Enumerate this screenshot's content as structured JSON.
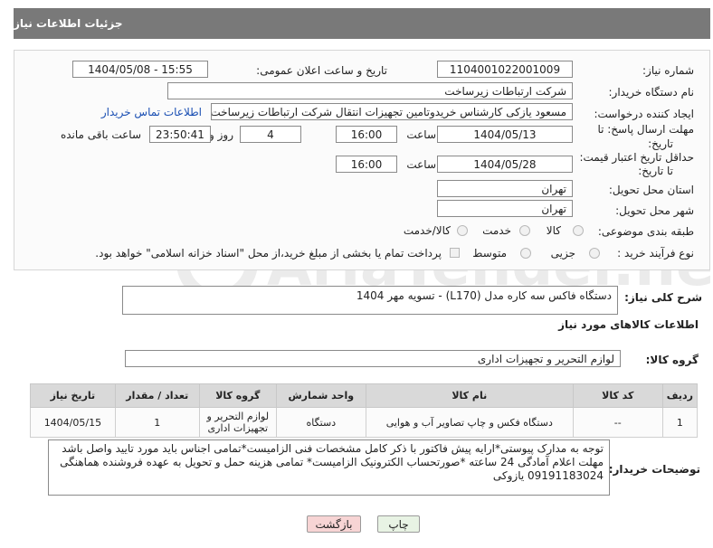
{
  "header": {
    "title": "جزئیات اطلاعات نیاز"
  },
  "form": {
    "need_number_label": "شماره نیاز:",
    "need_number": "1104001022001009",
    "announce_label": "تاریخ و ساعت اعلان عمومی:",
    "announce_value": "1404/05/08 - 15:55",
    "buyer_org_label": "نام دستگاه خریدار:",
    "buyer_org": "شرکت ارتباطات زیرساخت",
    "creator_label": "ایجاد کننده درخواست:",
    "creator": "مسعود یازکی کارشناس خریدوتامین تجهیزات انتقال شرکت ارتباطات زیرساخت",
    "contact_link": "اطلاعات تماس خریدار",
    "deadline_label_1": "مهلت ارسال پاسخ: تا",
    "deadline_label_2": "تاریخ:",
    "deadline_date": "1404/05/13",
    "time_label": "ساعت",
    "deadline_time": "16:00",
    "days_value": "4",
    "days_label": "روز و",
    "remaining_time": "23:50:41",
    "remaining_label": "ساعت باقی مانده",
    "min_price_label_1": "حداقل تاریخ اعتبار قیمت:",
    "min_price_label_2": "تا تاریخ:",
    "price_date": "1404/05/28",
    "price_time": "16:00",
    "province_label": "استان محل تحویل:",
    "province": "تهران",
    "city_label": "شهر محل تحویل:",
    "city": "تهران",
    "category_label": "طبقه بندی موضوعی:",
    "category_options": [
      "کالا",
      "خدمت",
      "کالا/خدمت"
    ],
    "process_label": "نوع فرآیند خرید :",
    "process_options": [
      "جزیی",
      "متوسط"
    ],
    "payment_text": "پرداخت تمام یا بخشی از مبلغ خرید،از محل \"اسناد خزانه اسلامی\" خواهد بود."
  },
  "description": {
    "label": "شرح کلی نیاز:",
    "value": "دستگاه فاکس سه کاره مدل (L170)  - تسویه مهر 1404"
  },
  "goods": {
    "section_title": "اطلاعات کالاهای مورد نیاز",
    "group_label": "گروه کالا:",
    "group_value": "لوازم التحریر و تجهیزات اداری",
    "columns": [
      "ردیف",
      "کد کالا",
      "نام کالا",
      "واحد شمارش",
      "گروه کالا",
      "تعداد / مقدار",
      "تاریخ نیاز"
    ],
    "rows": [
      [
        "1",
        "--",
        "دستگاه فکس و چاپ تصاویر آب و هوایی",
        "دستگاه",
        "لوازم التحریر و تجهیزات اداری",
        "1",
        "1404/05/15"
      ]
    ]
  },
  "notes": {
    "label": "توضیحات خریدار:",
    "value": "توجه به مدارک پیوستی*ارایه پیش فاکتور با ذکر کامل مشخصات فنی الزامیست*تمامی اجناس باید مورد تایید واصل باشد مهلت اعلام آمادگی 24 ساعته *صورتحساب الکترونیک الزامیست* تمامی هزینه حمل و تحویل به عهده فروشنده هماهنگی 09191183024 یازوکی"
  },
  "buttons": {
    "print": "چاپ",
    "back": "بازگشت"
  },
  "watermark": "AriaTender.net",
  "colors": {
    "titlebar": "#797979",
    "link": "#1a4fb3",
    "back_button": "#f7d4d4",
    "print_button": "#e8f3e4"
  }
}
